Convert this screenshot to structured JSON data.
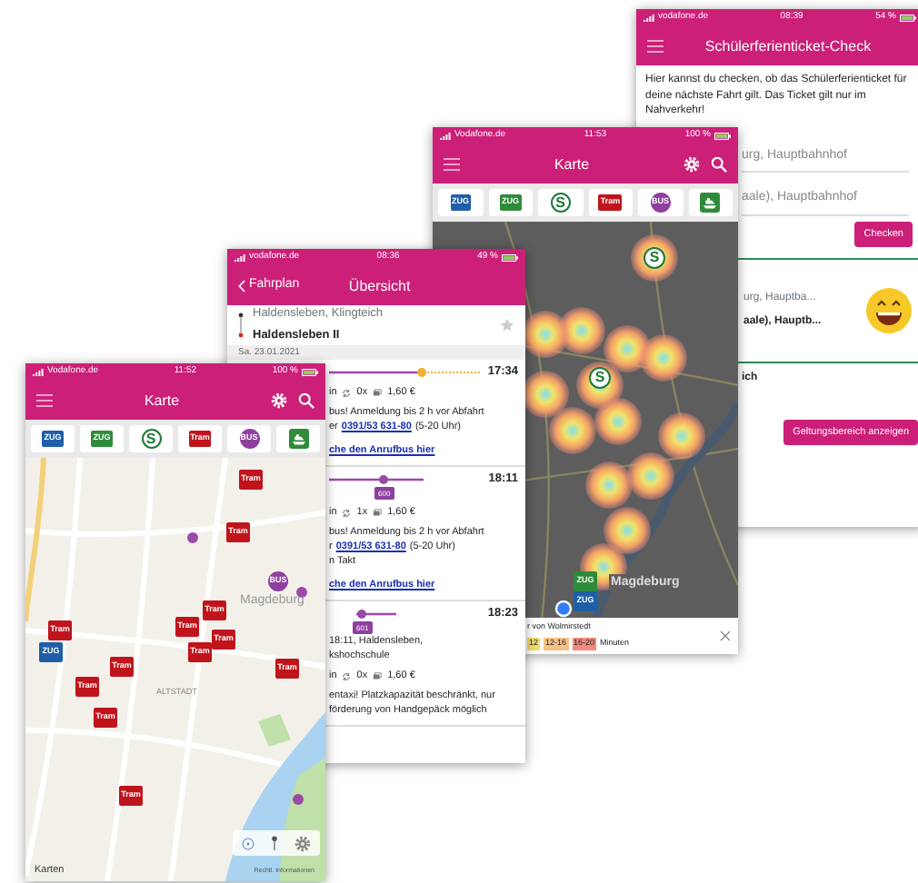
{
  "check_screen": {
    "status_bar": {
      "carrier": "vodafone.de",
      "time": "08:39",
      "battery": "54 %"
    },
    "title": "Schülerferienticket-Check",
    "intro": "Hier kannst du checken, ob das Schülerferienticket für deine nächste Fahrt gilt. Das Ticket gilt nur im Nahverkehr!",
    "from_field": {
      "value": "urg, Hauptbahnhof"
    },
    "to_field": {
      "value": "aale), Hauptbahnhof"
    },
    "check_button": "Checken",
    "result": {
      "from": "urg, Hauptba...",
      "to": "aale), Hauptb...",
      "valid": true
    },
    "section_label": "ich",
    "area_button": "Geltungsbereich anzeigen"
  },
  "heatmap_screen": {
    "status_bar": {
      "carrier": "Vodafone.de",
      "time": "11:53",
      "battery": "100 %"
    },
    "title": "Karte",
    "filters": [
      {
        "kind": "square",
        "label": "ZUG",
        "color": "#1f5fa8"
      },
      {
        "kind": "square",
        "label": "ZUG",
        "color": "#2e8b3a"
      },
      {
        "kind": "ring",
        "label": "S",
        "color": "#1d7a3a"
      },
      {
        "kind": "square",
        "label": "Tram",
        "color": "#c0141c"
      },
      {
        "kind": "circle",
        "label": "BUS",
        "color": "#8e3fa0"
      },
      {
        "kind": "icon",
        "color": "#2e8b3a"
      }
    ],
    "markers": [
      {
        "kind": "ring",
        "label": "S",
        "color": "#1d7a3a"
      },
      {
        "kind": "ring",
        "label": "S",
        "color": "#1d7a3a"
      },
      {
        "kind": "square",
        "label": "ZUG",
        "color": "#2e8b3a"
      },
      {
        "kind": "square",
        "label": "ZUG",
        "color": "#1f5fa8"
      }
    ],
    "map_label": "Magdeburg",
    "legend": {
      "caption": "r von Wolmirstedt",
      "bands": [
        {
          "label": "12",
          "color": "#f2dc6a"
        },
        {
          "label": "12-16",
          "color": "#f6c184"
        },
        {
          "label": "16-20",
          "color": "#ef8a7c"
        }
      ],
      "unit": "Minuten"
    }
  },
  "timetable_screen": {
    "status_bar": {
      "carrier": "vodafone.de",
      "time": "08:36",
      "battery": "49 %"
    },
    "back": "Fahrplan",
    "title": "Übersicht",
    "from": "Haldensleben, Klingteich",
    "to": "Haldensleben II",
    "favorite": false,
    "date": "Sa. 23.01.2021",
    "connections": [
      {
        "time": "17:34",
        "footpath": true,
        "info": "in",
        "transfers": "0x",
        "price": "1,60 €",
        "notes": [
          {
            "kind": "text",
            "text": "bus! Anmeldung bis 2 h vor Abfahrt"
          },
          {
            "kind": "phone",
            "prefix": "er",
            "number": "0391/53 631-80",
            "suffix": "(5-20 Uhr)"
          },
          {
            "kind": "link",
            "text": "che den Anrufbus hier"
          }
        ]
      },
      {
        "time": "18:11",
        "footpath": false,
        "badge": "600",
        "info": "in",
        "transfers": "1x",
        "price": "1,60 €",
        "notes": [
          {
            "kind": "text",
            "text": "bus! Anmeldung bis 2 h vor Abfahrt"
          },
          {
            "kind": "phone",
            "prefix": "r",
            "number": "0391/53 631-80",
            "suffix": "(5-20 Uhr)"
          },
          {
            "kind": "text",
            "text": "n Takt"
          },
          {
            "kind": "link",
            "text": "che den Anrufbus hier"
          }
        ]
      },
      {
        "time": "18:23",
        "footpath": false,
        "badge": "601",
        "stops": [
          "18:11, Haldensleben,",
          "kshochschule"
        ],
        "info": "in",
        "transfers": "0x",
        "price": "1,60 €",
        "notes": [
          {
            "kind": "text",
            "text": "entaxi! Platzkapazität beschränkt, nur"
          },
          {
            "kind": "text",
            "text": "förderung von Handgepäck möglich"
          }
        ]
      }
    ]
  },
  "map_screen": {
    "status_bar": {
      "carrier": "Vodafone.de",
      "time": "11:52",
      "battery": "100 %"
    },
    "title": "Karte",
    "filters": [
      {
        "kind": "square",
        "label": "ZUG",
        "color": "#1f5fa8"
      },
      {
        "kind": "square",
        "label": "ZUG",
        "color": "#2e8b3a"
      },
      {
        "kind": "ring",
        "label": "S",
        "color": "#1d7a3a"
      },
      {
        "kind": "square",
        "label": "Tram",
        "color": "#c0141c"
      },
      {
        "kind": "circle",
        "label": "BUS",
        "color": "#8e3fa0"
      },
      {
        "kind": "icon",
        "color": "#2e8b3a"
      }
    ],
    "markers": [
      {
        "kind": "square",
        "label": "Tram",
        "color": "#c0141c"
      },
      {
        "kind": "square",
        "label": "Tram",
        "color": "#c0141c"
      },
      {
        "kind": "square",
        "label": "Tram",
        "color": "#c0141c"
      },
      {
        "kind": "square",
        "label": "Tram",
        "color": "#c0141c"
      },
      {
        "kind": "square",
        "label": "Tram",
        "color": "#c0141c"
      },
      {
        "kind": "square",
        "label": "Tram",
        "color": "#c0141c"
      },
      {
        "kind": "square",
        "label": "Tram",
        "color": "#c0141c"
      },
      {
        "kind": "square",
        "label": "Tram",
        "color": "#c0141c"
      },
      {
        "kind": "square",
        "label": "Tram",
        "color": "#c0141c"
      },
      {
        "kind": "square",
        "label": "Tram",
        "color": "#c0141c"
      },
      {
        "kind": "square",
        "label": "Tram",
        "color": "#c0141c"
      },
      {
        "kind": "square",
        "label": "Tram",
        "color": "#c0141c"
      },
      {
        "kind": "circle",
        "label": "BUS",
        "color": "#8e3fa0"
      },
      {
        "kind": "square",
        "label": "ZUG",
        "color": "#1f5fa8"
      }
    ],
    "labels": [
      "Magdeburg",
      "ALTSTADT"
    ],
    "attribution": "Karten",
    "legal": "Rechtl. Informationen"
  }
}
